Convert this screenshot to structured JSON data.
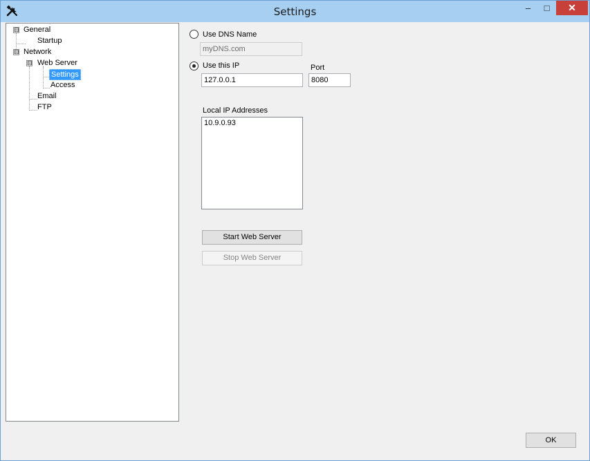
{
  "window": {
    "title": "Settings",
    "minimize_glyph": "–",
    "maximize_glyph": "□",
    "close_glyph": "✕",
    "app_icon": "tools-icon"
  },
  "tree": {
    "nodes": [
      {
        "label": "General",
        "expander": "⊟"
      },
      {
        "label": "Startup"
      },
      {
        "label": "Network",
        "expander": "⊟"
      },
      {
        "label": "Web Server",
        "expander": "⊟"
      },
      {
        "label": "Settings",
        "selected": true
      },
      {
        "label": "Access"
      },
      {
        "label": "Email"
      },
      {
        "label": "FTP"
      }
    ],
    "selection_color": "#3399ff"
  },
  "settings": {
    "dns_option_label": "Use DNS Name",
    "dns_option_selected": false,
    "dns_value": "myDNS.com",
    "ip_option_label": "Use this IP",
    "ip_option_selected": true,
    "ip_value": "127.0.0.1",
    "port_label": "Port",
    "port_value": "8080",
    "local_ip_label": "Local IP Addresses",
    "local_ips": [
      "10.9.0.93"
    ],
    "start_button": "Start Web Server",
    "stop_button": "Stop Web Server",
    "stop_button_enabled": false
  },
  "footer": {
    "ok_button": "OK"
  }
}
